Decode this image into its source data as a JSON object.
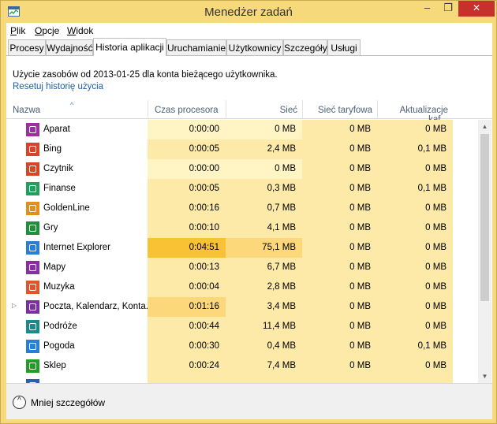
{
  "window": {
    "title": "Menedżer zadań",
    "colors": {
      "frame": "#f5d97b",
      "close": "#c7312c",
      "link": "#1a5fb4",
      "header_text": "#4c607a"
    }
  },
  "controls": {
    "minimize_glyph": "–",
    "maximize_glyph": "❐",
    "close_glyph": "✕"
  },
  "menu": [
    {
      "label": "Plik",
      "access": "P",
      "rest": "lik"
    },
    {
      "label": "Opcje",
      "access": "O",
      "rest": "pcje"
    },
    {
      "label": "Widok",
      "access": "W",
      "rest": "idok"
    }
  ],
  "tabs": [
    {
      "label": "Procesy",
      "active": false
    },
    {
      "label": "Wydajność",
      "active": false
    },
    {
      "label": "Historia aplikacji",
      "active": true
    },
    {
      "label": "Uruchamianie",
      "active": false
    },
    {
      "label": "Użytkownicy",
      "active": false
    },
    {
      "label": "Szczegóły",
      "active": false
    },
    {
      "label": "Usługi",
      "active": false
    }
  ],
  "info": {
    "usage_text": "Użycie zasobów od 2013-01-25 dla konta bieżącego użytkownika.",
    "reset_link": "Resetuj historię użycia"
  },
  "columns": {
    "name": "Nazwa",
    "cpu": "Czas procesora ...",
    "network": "Sieć",
    "metered": "Sieć taryfowa",
    "tile_updates": "Aktualizacje kaf..."
  },
  "rows": [
    {
      "name": "Aparat",
      "icon": "camera-app-icon",
      "icon_color": "#9a2fa3",
      "cpu": "0:00:00",
      "network": "0 MB",
      "metered": "0 MB",
      "tile": "0 MB",
      "cpu_heat": 0,
      "net_heat": 0,
      "expandable": false
    },
    {
      "name": "Bing",
      "icon": "bing-app-icon",
      "icon_color": "#d4452a",
      "cpu": "0:00:05",
      "network": "2,4 MB",
      "metered": "0 MB",
      "tile": "0,1 MB",
      "cpu_heat": 1,
      "net_heat": 1,
      "expandable": false
    },
    {
      "name": "Czytnik",
      "icon": "reader-app-icon",
      "icon_color": "#d4452a",
      "cpu": "0:00:00",
      "network": "0 MB",
      "metered": "0 MB",
      "tile": "0 MB",
      "cpu_heat": 0,
      "net_heat": 0,
      "expandable": false
    },
    {
      "name": "Finanse",
      "icon": "finance-app-icon",
      "icon_color": "#20a05a",
      "cpu": "0:00:05",
      "network": "0,3 MB",
      "metered": "0 MB",
      "tile": "0,1 MB",
      "cpu_heat": 1,
      "net_heat": 1,
      "expandable": false
    },
    {
      "name": "GoldenLine",
      "icon": "goldenline-app-icon",
      "icon_color": "#e38f1c",
      "cpu": "0:00:16",
      "network": "0,7 MB",
      "metered": "0 MB",
      "tile": "0 MB",
      "cpu_heat": 1,
      "net_heat": 1,
      "expandable": false
    },
    {
      "name": "Gry",
      "icon": "games-app-icon",
      "icon_color": "#1f8f3a",
      "cpu": "0:00:10",
      "network": "4,1 MB",
      "metered": "0 MB",
      "tile": "0 MB",
      "cpu_heat": 1,
      "net_heat": 1,
      "expandable": false
    },
    {
      "name": "Internet Explorer",
      "icon": "internet-explorer-icon",
      "icon_color": "#2a7fd4",
      "cpu": "0:04:51",
      "network": "75,1 MB",
      "metered": "0 MB",
      "tile": "0 MB",
      "cpu_heat": 3,
      "net_heat": 2,
      "expandable": false
    },
    {
      "name": "Mapy",
      "icon": "maps-app-icon",
      "icon_color": "#8a2fa3",
      "cpu": "0:00:13",
      "network": "6,7 MB",
      "metered": "0 MB",
      "tile": "0 MB",
      "cpu_heat": 1,
      "net_heat": 1,
      "expandable": false
    },
    {
      "name": "Muzyka",
      "icon": "music-app-icon",
      "icon_color": "#e0562a",
      "cpu": "0:00:04",
      "network": "2,8 MB",
      "metered": "0 MB",
      "tile": "0 MB",
      "cpu_heat": 1,
      "net_heat": 1,
      "expandable": false
    },
    {
      "name": "Poczta, Kalendarz, Konta...",
      "icon": "mail-app-icon",
      "icon_color": "#7a2fa3",
      "cpu": "0:01:16",
      "network": "3,4 MB",
      "metered": "0 MB",
      "tile": "0 MB",
      "cpu_heat": 2,
      "net_heat": 1,
      "expandable": true
    },
    {
      "name": "Podróże",
      "icon": "travel-app-icon",
      "icon_color": "#1a8a8a",
      "cpu": "0:00:44",
      "network": "11,4 MB",
      "metered": "0 MB",
      "tile": "0 MB",
      "cpu_heat": 1,
      "net_heat": 1,
      "expandable": false
    },
    {
      "name": "Pogoda",
      "icon": "weather-app-icon",
      "icon_color": "#2a7fd4",
      "cpu": "0:00:30",
      "network": "0,4 MB",
      "metered": "0 MB",
      "tile": "0,1 MB",
      "cpu_heat": 1,
      "net_heat": 1,
      "expandable": false
    },
    {
      "name": "Sklep",
      "icon": "store-app-icon",
      "icon_color": "#20a020",
      "cpu": "0:00:24",
      "network": "7,4 MB",
      "metered": "0 MB",
      "tile": "0 MB",
      "cpu_heat": 1,
      "net_heat": 1,
      "expandable": false
    },
    {
      "name": "",
      "icon": "partial-app-icon",
      "icon_color": "#2a5fb4",
      "cpu": "",
      "network": "",
      "metered": "",
      "tile": "",
      "cpu_heat": 1,
      "net_heat": 1,
      "expandable": false
    }
  ],
  "heat_colors": [
    "#fff4c4",
    "#fde9a8",
    "#fcd87a",
    "#f9c235"
  ],
  "footer": {
    "fewer_details": "Mniej szczegółów",
    "fewer_icon": "^"
  }
}
